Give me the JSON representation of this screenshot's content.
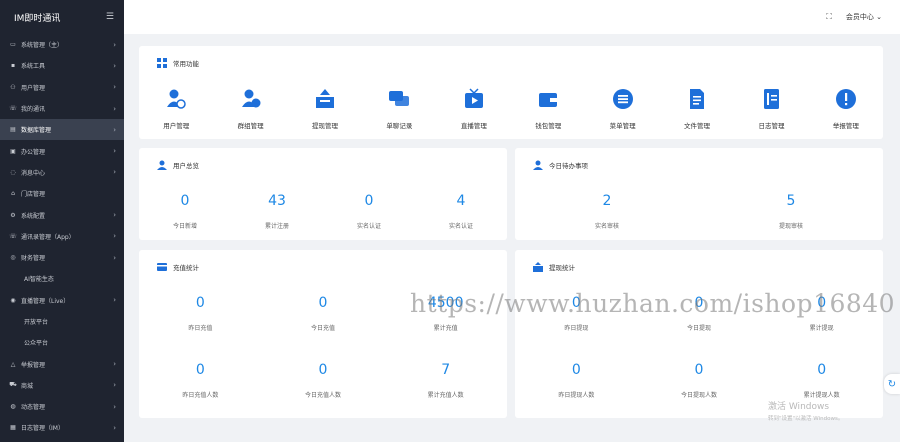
{
  "sidebar": {
    "title": "IM即时通讯",
    "items": [
      {
        "icon": "monitor-icon",
        "label": "系统管理（主）",
        "arrow": true
      },
      {
        "icon": "tool-icon",
        "label": "系统工具",
        "arrow": true
      },
      {
        "icon": "users-icon",
        "label": "用户管理",
        "arrow": true
      },
      {
        "icon": "phone-icon",
        "label": "我的通讯",
        "arrow": true
      },
      {
        "icon": "database-icon",
        "label": "数据库管理",
        "arrow": true,
        "active": true
      },
      {
        "icon": "briefcase-icon",
        "label": "办公管理",
        "arrow": true
      },
      {
        "icon": "chat-icon",
        "label": "消息中心",
        "arrow": true
      },
      {
        "icon": "box-icon",
        "label": "门店管理",
        "arrow": false
      },
      {
        "icon": "gear-icon",
        "label": "系统配置",
        "arrow": true
      },
      {
        "icon": "phone-icon",
        "label": "通讯录管理（App）",
        "arrow": true
      },
      {
        "icon": "finance-icon",
        "label": "财务管理",
        "arrow": true
      },
      {
        "icon": "",
        "label": "AI智能生态",
        "arrow": false,
        "sub": true
      },
      {
        "icon": "live-icon",
        "label": "直播管理（Live）",
        "arrow": true
      },
      {
        "icon": "",
        "label": "开放平台",
        "arrow": false,
        "sub": true
      },
      {
        "icon": "",
        "label": "公众平台",
        "arrow": false,
        "sub": true
      },
      {
        "icon": "warning-icon",
        "label": "举报管理",
        "arrow": true
      },
      {
        "icon": "cart-icon",
        "label": "商城",
        "arrow": true
      },
      {
        "icon": "activity-icon",
        "label": "动态管理",
        "arrow": true
      },
      {
        "icon": "log-icon",
        "label": "日志管理（IM）",
        "arrow": true
      }
    ]
  },
  "topbar": {
    "fullscreen_icon": "⛶",
    "member_label": "会员中心"
  },
  "functions": {
    "title": "常用功能",
    "items": [
      {
        "label": "用户管理",
        "icon": "user-manage-icon",
        "color": "#1e6fd9"
      },
      {
        "label": "群组管理",
        "icon": "group-manage-icon",
        "color": "#1e6fd9"
      },
      {
        "label": "提现管理",
        "icon": "withdraw-icon",
        "color": "#1e6fd9"
      },
      {
        "label": "单聊记录",
        "icon": "chat-record-icon",
        "color": "#1e6fd9"
      },
      {
        "label": "直播管理",
        "icon": "live-manage-icon",
        "color": "#1e6fd9"
      },
      {
        "label": "钱包管理",
        "icon": "wallet-icon",
        "color": "#1e6fd9"
      },
      {
        "label": "菜单管理",
        "icon": "menu-manage-icon",
        "color": "#1e6fd9"
      },
      {
        "label": "文件管理",
        "icon": "file-manage-icon",
        "color": "#1e6fd9"
      },
      {
        "label": "日志管理",
        "icon": "log-manage-icon",
        "color": "#1e6fd9"
      },
      {
        "label": "举报管理",
        "icon": "report-manage-icon",
        "color": "#1e6fd9"
      }
    ]
  },
  "user_overview": {
    "title": "用户总览",
    "stats": [
      {
        "value": "0",
        "label": "今日新增"
      },
      {
        "value": "43",
        "label": "累计注册"
      },
      {
        "value": "0",
        "label": "实名认证"
      },
      {
        "value": "4",
        "label": "实名认证"
      }
    ]
  },
  "todo": {
    "title": "今日待办事项",
    "stats": [
      {
        "value": "2",
        "label": "实名审核"
      },
      {
        "value": "5",
        "label": "提现审核"
      }
    ]
  },
  "recharge": {
    "title": "充值统计",
    "stats_row1": [
      {
        "value": "0",
        "label": "昨日充值"
      },
      {
        "value": "0",
        "label": "今日充值"
      },
      {
        "value": "4500",
        "label": "累计充值"
      }
    ],
    "stats_row2": [
      {
        "value": "0",
        "label": "昨日充值人数"
      },
      {
        "value": "0",
        "label": "今日充值人数"
      },
      {
        "value": "7",
        "label": "累计充值人数"
      }
    ]
  },
  "withdraw": {
    "title": "提现统计",
    "stats_row1": [
      {
        "value": "0",
        "label": "昨日提现"
      },
      {
        "value": "0",
        "label": "今日提现"
      },
      {
        "value": "0",
        "label": "累计提现"
      }
    ],
    "stats_row2": [
      {
        "value": "0",
        "label": "昨日提现人数"
      },
      {
        "value": "0",
        "label": "今日提现人数"
      },
      {
        "value": "0",
        "label": "累计提现人数"
      }
    ]
  },
  "watermark": "https://www.huzhan.com/ishop16840",
  "windows_activation": {
    "line1": "激活 Windows",
    "line2": "转到\"设置\"以激活 Windows。"
  },
  "colors": {
    "accent": "#1e88e5",
    "sidebar_bg": "#1f2430",
    "active_bg": "#3a4150"
  }
}
